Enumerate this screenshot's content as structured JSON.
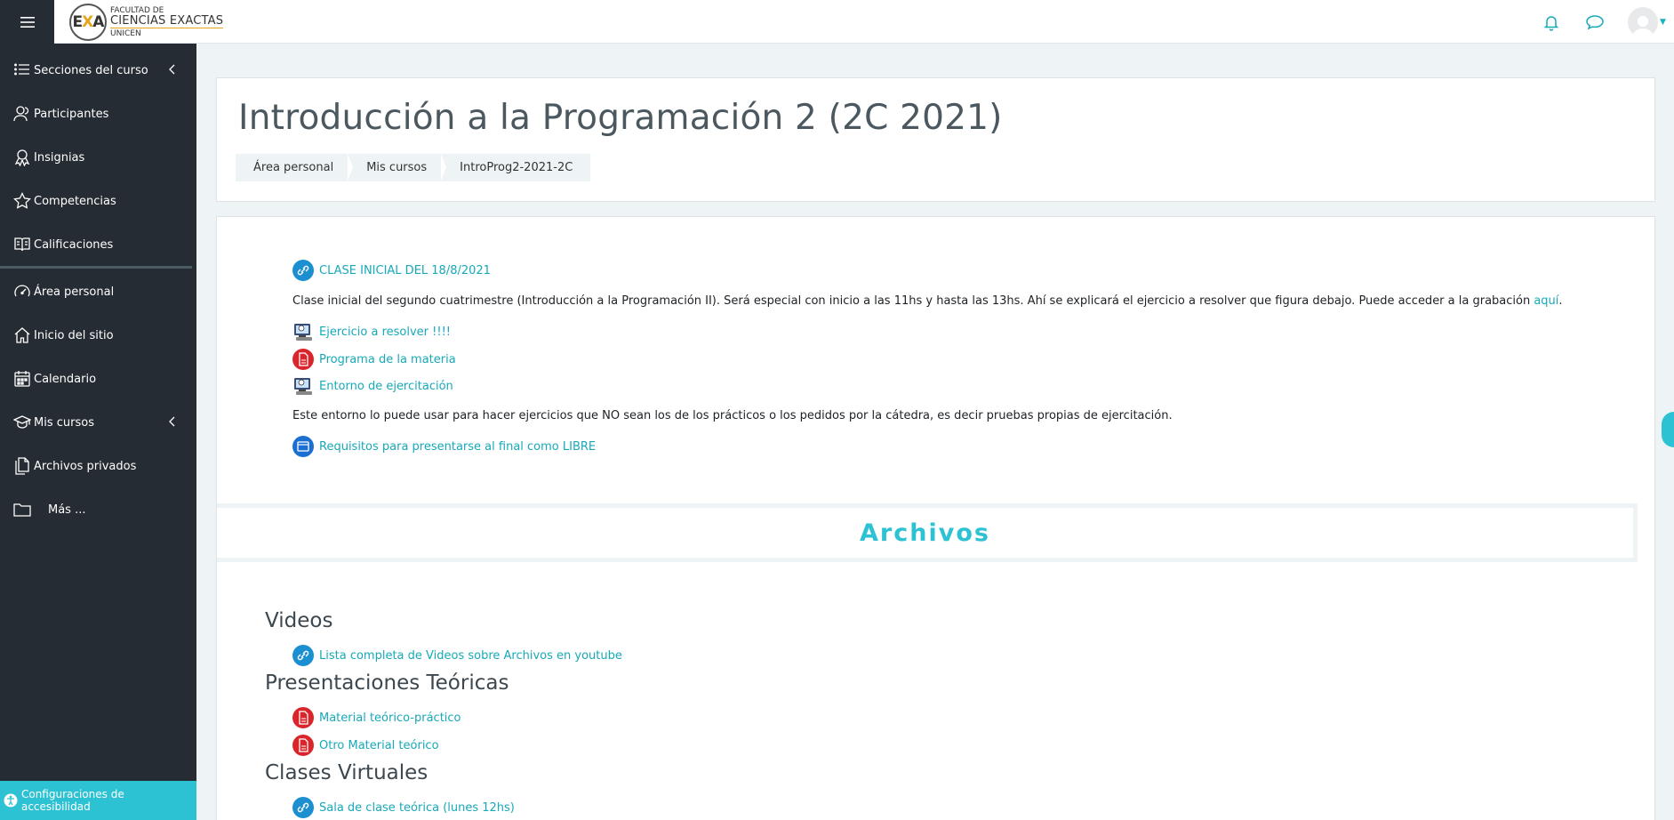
{
  "logo": {
    "letters": "EXA",
    "line1": "FACULTAD DE",
    "line2": "CIENCIAS EXACTAS",
    "line3": "UNICEN"
  },
  "colors": {
    "accent": "#2cc2d3",
    "link": "#17a9b8",
    "sidebar": "#262c33",
    "pdf": "#d9262c"
  },
  "header_icons": [
    "bell-icon",
    "chat-icon",
    "user-avatar"
  ],
  "sidebar": {
    "items": [
      {
        "label": "Secciones del curso",
        "icon": "list-icon"
      },
      {
        "label": "Participantes",
        "icon": "users-icon"
      },
      {
        "label": "Insignias",
        "icon": "badge-icon"
      },
      {
        "label": "Competencias",
        "icon": "star-icon"
      },
      {
        "label": "Calificaciones",
        "icon": "book-icon"
      },
      {
        "label": "Área personal",
        "icon": "dashboard-icon"
      },
      {
        "label": "Inicio del sitio",
        "icon": "home-icon"
      },
      {
        "label": "Calendario",
        "icon": "calendar-icon"
      },
      {
        "label": "Mis cursos",
        "icon": "graduation-cap-icon"
      },
      {
        "label": "Archivos privados",
        "icon": "files-icon"
      },
      {
        "label": "Más ...",
        "icon": "folder-icon"
      }
    ],
    "accessibility": "Configuraciones de accesibilidad"
  },
  "header": {
    "title": "Introducción a la Programación 2 (2C 2021)",
    "breadcrumb": [
      "Área personal",
      "Mis cursos",
      "IntroProg2-2021-2C"
    ]
  },
  "content": {
    "clase_inicial": "CLASE INICIAL DEL 18/8/2021",
    "clase_desc": "Clase inicial del segundo cuatrimestre (Introducción a la Programación II). Será especial con inicio a las 11hs y hasta las 13hs. Ahí se explicará el ejercicio a resolver que figura debajo. Puede acceder a la grabación ",
    "clase_link": "aquí",
    "clase_end": ".",
    "ejercicio": "Ejercicio a resolver !!!!",
    "programa": "Programa de la materia",
    "entorno": "Entorno de ejercitación",
    "entorno_desc": "Este entorno lo puede usar para hacer ejercicios que NO sean los de los prácticos o los pedidos por la cátedra, es decir pruebas propias de ejercitación.",
    "requisitos": "Requisitos para presentarse al final como LIBRE",
    "section_title": "Archivos",
    "videos_head": "Videos",
    "videos_link": "Lista completa de Videos sobre Archivos en youtube",
    "present_head": "Presentaciones Teóricas",
    "material1": "Material teórico-práctico",
    "material2": "Otro Material teórico",
    "clases_head": "Clases Virtuales",
    "sala": "Sala de clase teórica (lunes 12hs)"
  }
}
